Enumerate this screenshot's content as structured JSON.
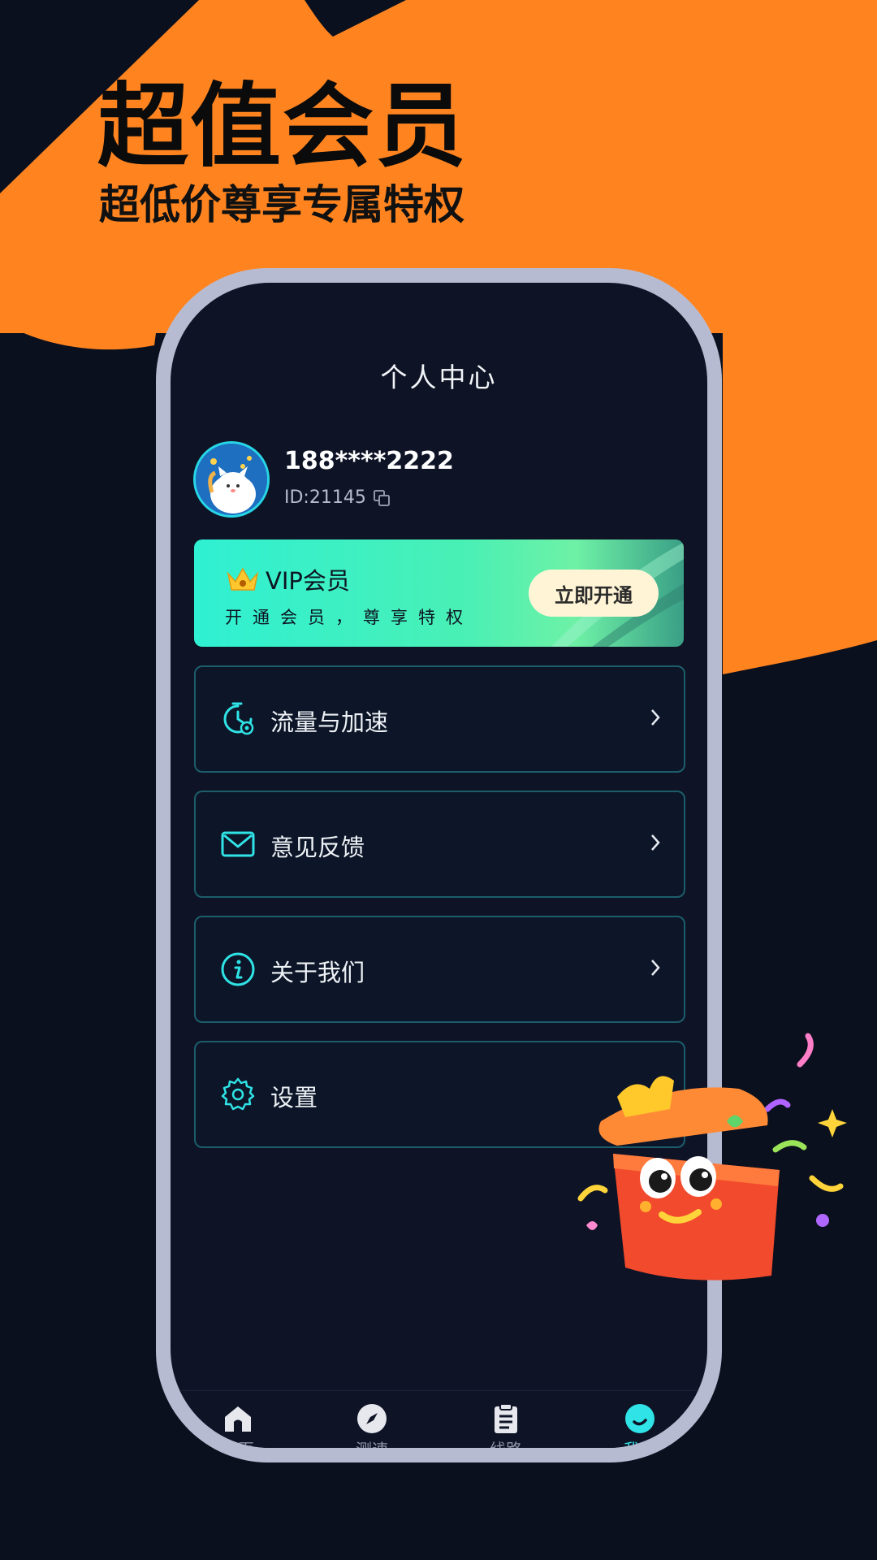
{
  "hero": {
    "title": "超值会员",
    "subtitle": "超低价尊享专属特权"
  },
  "screen": {
    "title": "个人中心",
    "profile": {
      "phone": "188****2222",
      "id_text": "ID:21145"
    },
    "vip": {
      "title": "VIP会员",
      "subtitle": "开通会员，尊享特权",
      "button": "立即开通"
    },
    "menu": [
      {
        "label": "流量与加速",
        "icon": "traffic-speed-icon"
      },
      {
        "label": "意见反馈",
        "icon": "mail-icon"
      },
      {
        "label": "关于我们",
        "icon": "info-icon"
      },
      {
        "label": "设置",
        "icon": "gear-icon"
      }
    ],
    "tabs": [
      {
        "label": "首页",
        "icon": "home-icon"
      },
      {
        "label": "测速",
        "icon": "compass-icon"
      },
      {
        "label": "线路",
        "icon": "clipboard-icon"
      },
      {
        "label": "我的",
        "icon": "profile-icon",
        "active": true
      }
    ]
  },
  "colors": {
    "orange": "#ff8420",
    "background": "#0a101d",
    "accent": "#2fe3e6",
    "phone_frame": "#b6bbd2"
  }
}
